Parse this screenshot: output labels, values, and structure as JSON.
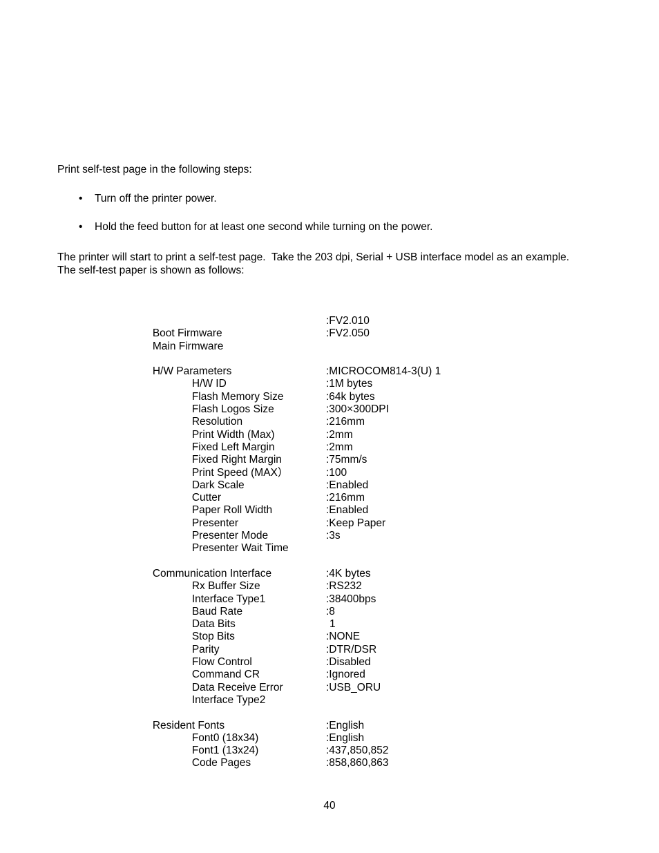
{
  "document": {
    "page_number": "40",
    "intro": "Print self-test page in the following steps:",
    "steps": [
      "Turn off the printer power.",
      "Hold the feed button for at least one second while turning on the power."
    ],
    "bullet_glyph": "•",
    "closing": [
      "The printer will start to print a self-test page.  Take the 203 dpi, Serial + USB interface model as an example.",
      "The self-test paper is shown as follows:"
    ]
  },
  "selftest": {
    "firmware": [
      {
        "label": "Boot Firmware",
        "value": ":FV2.010"
      },
      {
        "label": "Main Firmware",
        "value": ":FV2.050"
      }
    ],
    "sections": [
      {
        "title": "H/W Parameters",
        "rows": [
          {
            "label": "H/W ID",
            "value": ":MICROCOM814-3(U) 1"
          },
          {
            "label": "Flash Memory Size",
            "value": ":1M bytes"
          },
          {
            "label": "Flash Logos Size",
            "value": ":64k bytes"
          },
          {
            "label": "Resolution",
            "value": ":300×300DPI"
          },
          {
            "label": "Print Width (Max)",
            "value": ":216mm"
          },
          {
            "label": "Fixed Left Margin",
            "value": ":2mm"
          },
          {
            "label": "Fixed Right Margin",
            "value": ":2mm"
          },
          {
            "label": "Print Speed (MAX）",
            "value": ":75mm/s"
          },
          {
            "label": "Dark Scale",
            "value": ":100"
          },
          {
            "label": "Cutter",
            "value": ":Enabled"
          },
          {
            "label": "Paper Roll Width",
            "value": ":216mm"
          },
          {
            "label": "Presenter",
            "value": ":Enabled"
          },
          {
            "label": "Presenter Mode",
            "value": ":Keep Paper"
          },
          {
            "label": "Presenter Wait Time",
            "value": ":3s"
          }
        ]
      },
      {
        "title": "Communication Interface",
        "rows": [
          {
            "label": "Rx Buffer Size",
            "value": ":4K bytes"
          },
          {
            "label": "Interface Type1",
            "value": ":RS232"
          },
          {
            "label": "Baud Rate",
            "value": ":38400bps"
          },
          {
            "label": "Data Bits",
            "value": ":8"
          },
          {
            "label": "Stop Bits",
            "value": "1"
          },
          {
            "label": "Parity",
            "value": ":NONE"
          },
          {
            "label": "Flow Control",
            "value": ":DTR/DSR"
          },
          {
            "label": "Command CR",
            "value": ":Disabled"
          },
          {
            "label": "Data Receive Error",
            "value": ":Ignored"
          },
          {
            "label": "Interface Type2",
            "value": ":USB_ORU"
          }
        ]
      },
      {
        "title": "Resident Fonts",
        "rows": [
          {
            "label": "Font0 (18x34)",
            "value": ":English"
          },
          {
            "label": "Font1 (13x24)",
            "value": ":English"
          },
          {
            "label": "Code Pages",
            "value": ":437,850,852"
          },
          {
            "label": "",
            "value": ":858,860,863"
          }
        ]
      }
    ]
  }
}
